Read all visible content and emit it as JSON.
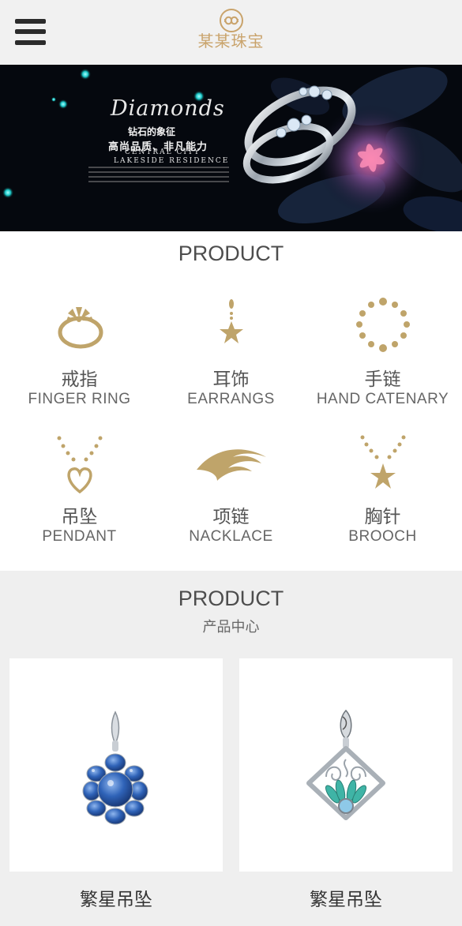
{
  "header": {
    "logo_text": "某某珠宝",
    "colors": {
      "gold": "#c9a36b",
      "menu": "#2b2b2b"
    }
  },
  "banner": {
    "script_title": "Diamonds",
    "slogan_line1": "钻石的象征",
    "slogan_line2": "高尚品质、非凡能力",
    "slogan_line3": "CENTRAL CITY",
    "slogan_line4": "LAKESIDE RESIDENCE"
  },
  "categories": {
    "title": "PRODUCT",
    "items": [
      {
        "cn": "戒指",
        "en": "FINGER RING",
        "icon": "ring-icon"
      },
      {
        "cn": "耳饰",
        "en": "EARRANGS",
        "icon": "earring-icon"
      },
      {
        "cn": "手链",
        "en": "HAND CATENARY",
        "icon": "bracelet-icon"
      },
      {
        "cn": "吊坠",
        "en": "PENDANT",
        "icon": "pendant-icon"
      },
      {
        "cn": "项链",
        "en": "NACKLACE",
        "icon": "necklace-icon"
      },
      {
        "cn": "胸针",
        "en": "BROOCH",
        "icon": "brooch-icon"
      }
    ],
    "icon_color": "#bfa46a"
  },
  "products": {
    "title": "PRODUCT",
    "subtitle": "产品中心",
    "items": [
      {
        "name": "繁星吊坠",
        "image": "blue-sapphire-pendant"
      },
      {
        "name": "繁星吊坠",
        "image": "turquoise-filigree-pendant"
      }
    ]
  }
}
